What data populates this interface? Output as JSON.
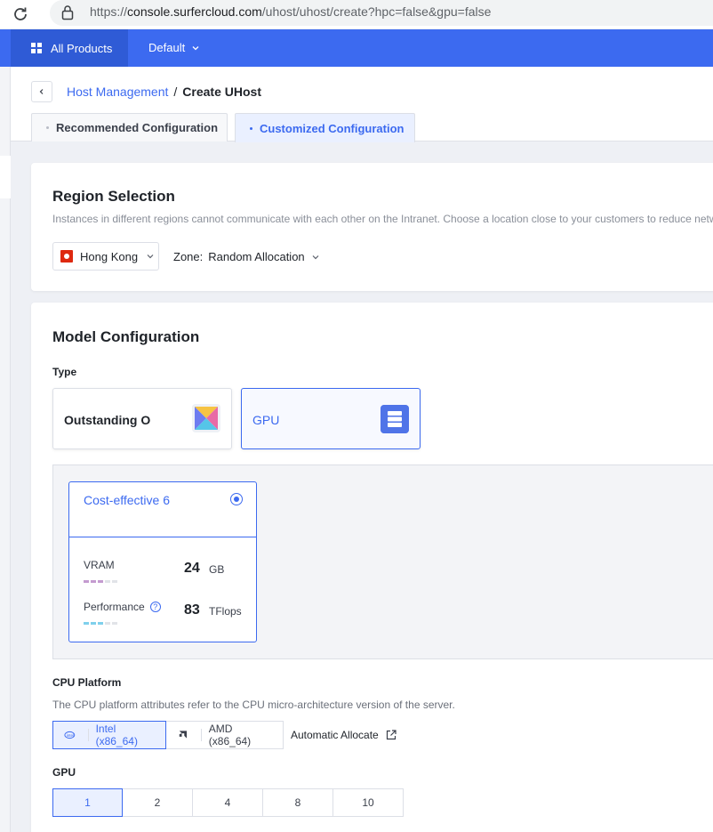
{
  "browser": {
    "url_prefix": "https://",
    "url_host": "console.surfercloud.com",
    "url_path": "/uhost/uhost/create?hpc=false&gpu=false"
  },
  "topnav": {
    "all_products": "All Products",
    "project": "Default"
  },
  "breadcrumb": {
    "parent": "Host Management",
    "separator": "/",
    "current": "Create UHost"
  },
  "tabs": [
    {
      "label": "Recommended Configuration",
      "active": false
    },
    {
      "label": "Customized Configuration",
      "active": true
    }
  ],
  "region": {
    "title": "Region Selection",
    "description": "Instances in different regions cannot communicate with each other on the Intranet. Choose a location close to your customers to reduce netw",
    "selected_region": "Hong Kong",
    "zone_label": "Zone:",
    "zone_value": "Random Allocation"
  },
  "model": {
    "title": "Model Configuration",
    "type_label": "Type",
    "types": [
      {
        "name": "Outstanding O",
        "icon": "kite-logo-icon",
        "active": false
      },
      {
        "name": "GPU",
        "icon": "server-icon",
        "active": true
      }
    ],
    "option": {
      "name": "Cost-effective 6",
      "selected": true,
      "vram_label": "VRAM",
      "vram_value": "24",
      "vram_unit": "GB",
      "perf_label": "Performance",
      "perf_value": "83",
      "perf_unit": "TFlops"
    },
    "cpu_platform": {
      "label": "CPU Platform",
      "description": "The CPU platform attributes refer to the CPU micro-architecture version of the server.",
      "options": [
        {
          "label": "Intel (x86_64)",
          "active": true
        },
        {
          "label": "AMD (x86_64)",
          "active": false
        }
      ],
      "auto_label": "Automatic Allocate"
    },
    "gpu": {
      "label": "GPU",
      "options": [
        "1",
        "2",
        "4",
        "8",
        "10"
      ],
      "selected": "1"
    }
  },
  "colors": {
    "accent": "#3c6af0",
    "nav_bg": "#3c6af0",
    "vram_bar": "#c49bd0",
    "perf_bar": "#7fd0ec"
  }
}
